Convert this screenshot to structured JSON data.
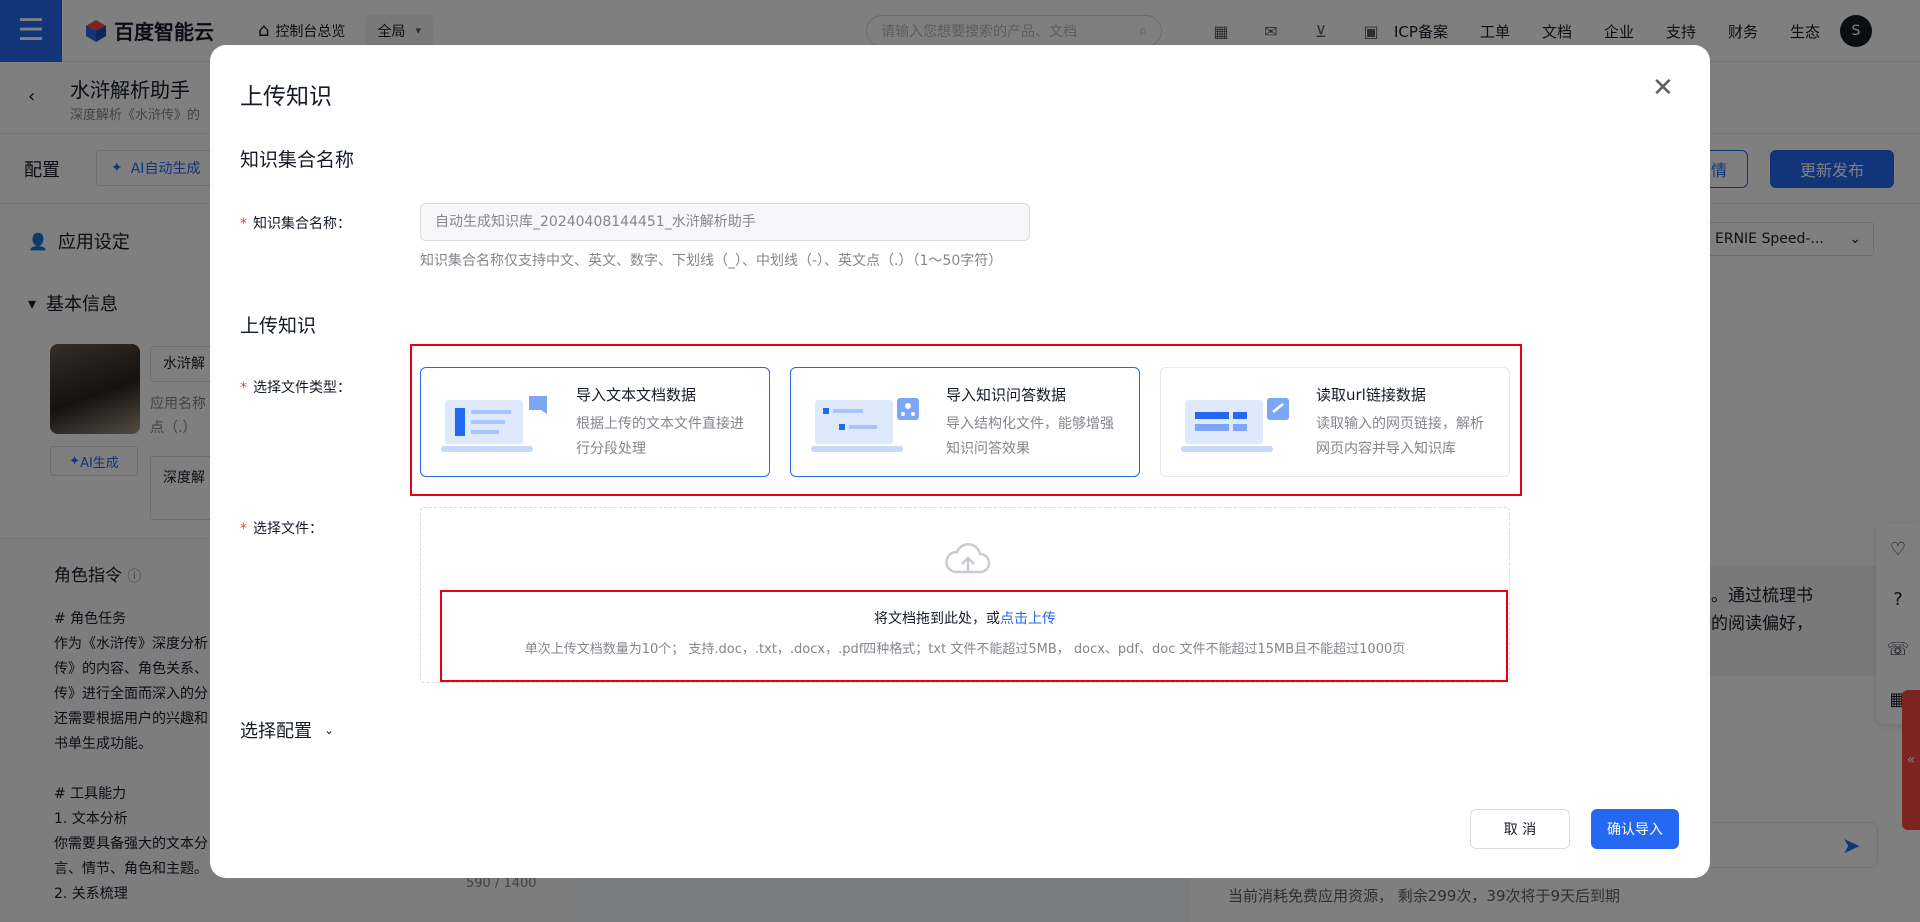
{
  "topbar": {
    "brand": "百度智能云",
    "console_link": "控制台总览",
    "region": "全局",
    "search_placeholder": "请输入您想要搜索的产品、文档",
    "nav": [
      "ICP备案",
      "工单",
      "文档",
      "企业",
      "支持",
      "财务",
      "生态"
    ],
    "avatar_initial": "S"
  },
  "app": {
    "title": "水浒解析助手",
    "subtitle": "深度解析《水浒传》的"
  },
  "config_bar": {
    "label": "配置",
    "ai_auto": "AI自动生成",
    "ghost_btn": "情",
    "publish": "更新发布"
  },
  "left": {
    "app_settings": "应用设定",
    "basic_info": "基本信息",
    "name_value": "水浒解",
    "name_hint_1": "应用名称",
    "name_hint_2": "点（.）",
    "ai_btn": "AI生成",
    "desc_value": "深度解",
    "role_title": "角色指令",
    "role_text": "# 角色任务\n作为《水浒传》深度分析\n传》的内容、角色关系、\n传》进行全面而深入的分\n还需要根据用户的兴趣和\n书单生成功能。\n\n# 工具能力\n1. 文本分析\n你需要具备强大的文本分\n言、情节、角色和主题。\n2. 关系梳理",
    "counter": "590 / 1400"
  },
  "right": {
    "model": "ERNIE Speed-...",
    "chat_text": "务。通过梳理书\n你的阅读偏好，",
    "footer": "当前消耗免费应用资源， 剩余299次，39次将于9天后到期"
  },
  "modal": {
    "title": "上传知识",
    "kb_section": "知识集合名称",
    "kb_label": "知识集合名称：",
    "kb_value": "自动生成知识库_20240408144451_水浒解析助手",
    "kb_hint": "知识集合名称仅支持中文、英文、数字、下划线（_）、中划线（-）、英文点（.）（1～50字符）",
    "upload_section": "上传知识",
    "file_type_label": "选择文件类型：",
    "cards": [
      {
        "title": "导入文本文档数据",
        "desc": "根据上传的文本文件直接进行分段处理",
        "selected": true
      },
      {
        "title": "导入知识问答数据",
        "desc": "导入结构化文件，能够增强知识问答效果",
        "selected": true
      },
      {
        "title": "读取url链接数据",
        "desc": "读取输入的网页链接，解析网页内容并导入知识库",
        "selected": false
      }
    ],
    "file_label": "选择文件：",
    "drop_main": "将文档拖到此处，或",
    "drop_link": "点击上传",
    "drop_hint": "单次上传文档数量为10个；  支持.doc，.txt，.docx，.pdf四种格式；txt 文件不能超过5MB，  docx、pdf、doc 文件不能超过15MB且不能超过1000页",
    "select_config": "选择配置",
    "cancel": "取 消",
    "confirm": "确认导入"
  },
  "colors": {
    "primary": "#2468f2",
    "highlight": "#e60012",
    "required": "#f33e3e"
  }
}
